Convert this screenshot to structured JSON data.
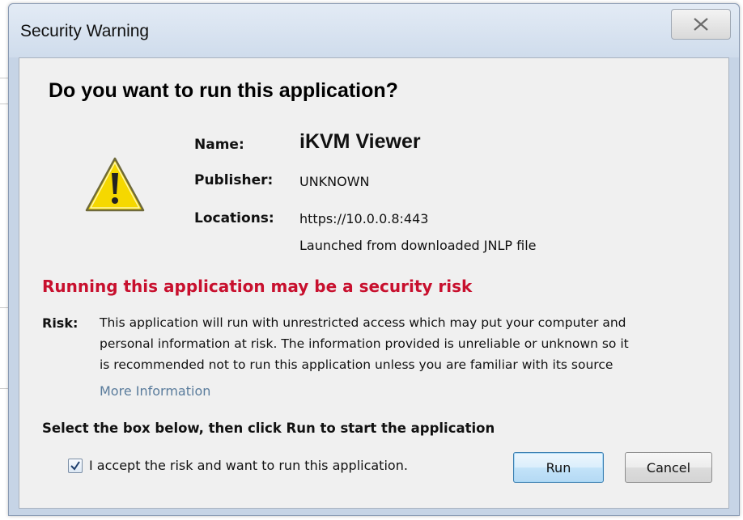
{
  "window": {
    "title": "Security Warning",
    "close_icon": "close-icon"
  },
  "heading": "Do you want to run this application?",
  "icon": "warning-icon",
  "details": {
    "name_label": "Name:",
    "name_value": "iKVM Viewer",
    "publisher_label": "Publisher:",
    "publisher_value": "UNKNOWN",
    "locations_label": "Locations:",
    "locations_value": "https://10.0.0.8:443",
    "locations_note": "Launched from downloaded JNLP file"
  },
  "risk": {
    "heading": "Running this application may be a security risk",
    "label": "Risk:",
    "lines": [
      "This application will run with unrestricted access which may put your computer and",
      "personal information at risk. The information provided is unreliable or unknown so it",
      "is recommended not to run this application unless you are familiar with its source"
    ],
    "more_info": "More Information"
  },
  "instruction": "Select the box below, then click Run to start the application",
  "accept": {
    "label": "I accept the risk and want to run this application.",
    "checked": true
  },
  "buttons": {
    "run": "Run",
    "cancel": "Cancel"
  },
  "colors": {
    "risk_red": "#c8102e",
    "link": "#5a7c9c",
    "warning_yellow": "#f5d800"
  }
}
